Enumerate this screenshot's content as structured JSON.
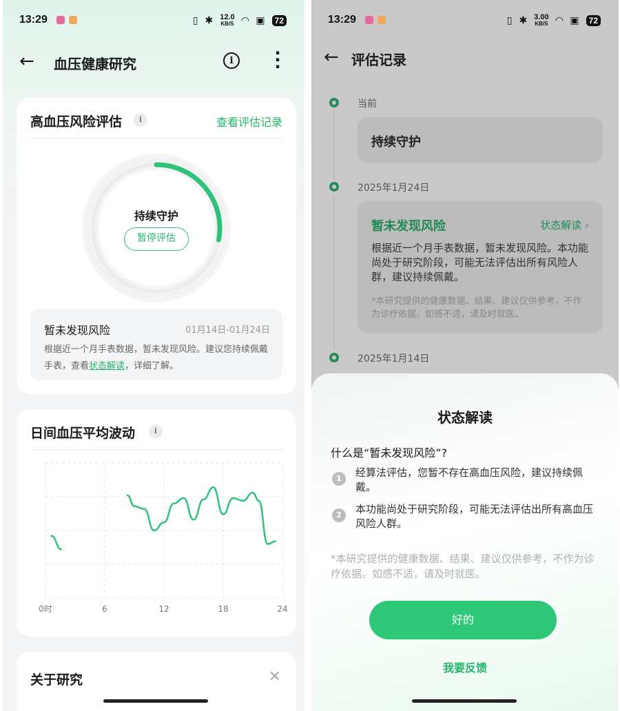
{
  "left": {
    "status": {
      "time": "13:29",
      "speed_value": "12.0",
      "speed_unit": "KB/S",
      "battery": "72"
    },
    "nav": {
      "title": "血压健康研究",
      "back_icon": "back-arrow-icon",
      "info_icon": "info-icon",
      "more_icon": "more-vert-icon"
    },
    "risk_card": {
      "title": "高血压风险评估",
      "link": "查看评估记录",
      "ring_label": "持续守护",
      "pause_button": "暂停评估",
      "progress_fraction": 0.28,
      "summary": {
        "title": "暂未发现风险",
        "date": "01月14日-01月24日",
        "body_prefix": "根据近一个月手表数据，暂未发现风险。建议您持续佩戴手表，查看",
        "body_link": "状态解读",
        "body_suffix": "，详细了解。"
      }
    },
    "chart_card": {
      "title": "日间血压平均波动"
    },
    "about_card": {
      "title": "关于研究",
      "close_icon": "close-icon"
    },
    "colors": {
      "accent": "#2fc27a"
    }
  },
  "chart_data": {
    "type": "line",
    "title": "日间血压平均波动",
    "x_ticks": [
      "0时",
      "6",
      "12",
      "18",
      "24"
    ],
    "xlim": [
      0,
      24
    ],
    "ylim": [
      0,
      100
    ],
    "grid": true,
    "series": [
      {
        "points": [
          [
            0.6,
            46
          ],
          [
            1.6,
            36
          ]
        ]
      },
      {
        "points": [
          [
            8.3,
            76
          ],
          [
            9.0,
            68
          ],
          [
            10,
            66
          ],
          [
            11,
            50
          ],
          [
            12,
            56
          ],
          [
            13,
            70
          ],
          [
            14,
            74
          ],
          [
            15,
            58
          ],
          [
            16,
            73
          ],
          [
            17,
            82
          ],
          [
            18,
            62
          ],
          [
            19,
            74
          ],
          [
            20,
            72
          ],
          [
            21,
            78
          ],
          [
            21.6,
            72
          ],
          [
            22.5,
            40
          ],
          [
            23.3,
            42
          ]
        ]
      }
    ]
  },
  "right": {
    "status": {
      "time": "13:29",
      "speed_value": "3.00",
      "speed_unit": "KB/S",
      "battery": "72"
    },
    "nav": {
      "title": "评估记录",
      "back_icon": "back-arrow-icon"
    },
    "timeline": {
      "current_label": "当前",
      "current_status": "持续守护",
      "entry1_date": "2025年1月24日",
      "entry1_title": "暂未发现风险",
      "entry1_link": "状态解读",
      "entry1_body": "根据近一个月手表数据，暂未发现风险。本功能尚处于研究阶段，可能无法评估出所有风险人群，建议持续佩戴。",
      "entry1_note": "*本研究提供的健康数据、结果、建议仅供参考，不作为诊疗依据。如感不适，请及时就医。",
      "entry2_date": "2025年1月14日"
    },
    "sheet": {
      "title": "状态解读",
      "question": "什么是“暂未发现风险”?",
      "item1_num": "1",
      "item1": "经算法评估，您暂不存在高血压风险，建议持续佩戴。",
      "item2_num": "2",
      "item2": "本功能尚处于研究阶段，可能无法评估出所有高血压风险人群。",
      "note": "*本研究提供的健康数据、结果、建议仅供参考，不作为诊疗依据。如感不适，请及时就医。",
      "ok_button": "好的",
      "feedback": "我要反馈"
    }
  }
}
